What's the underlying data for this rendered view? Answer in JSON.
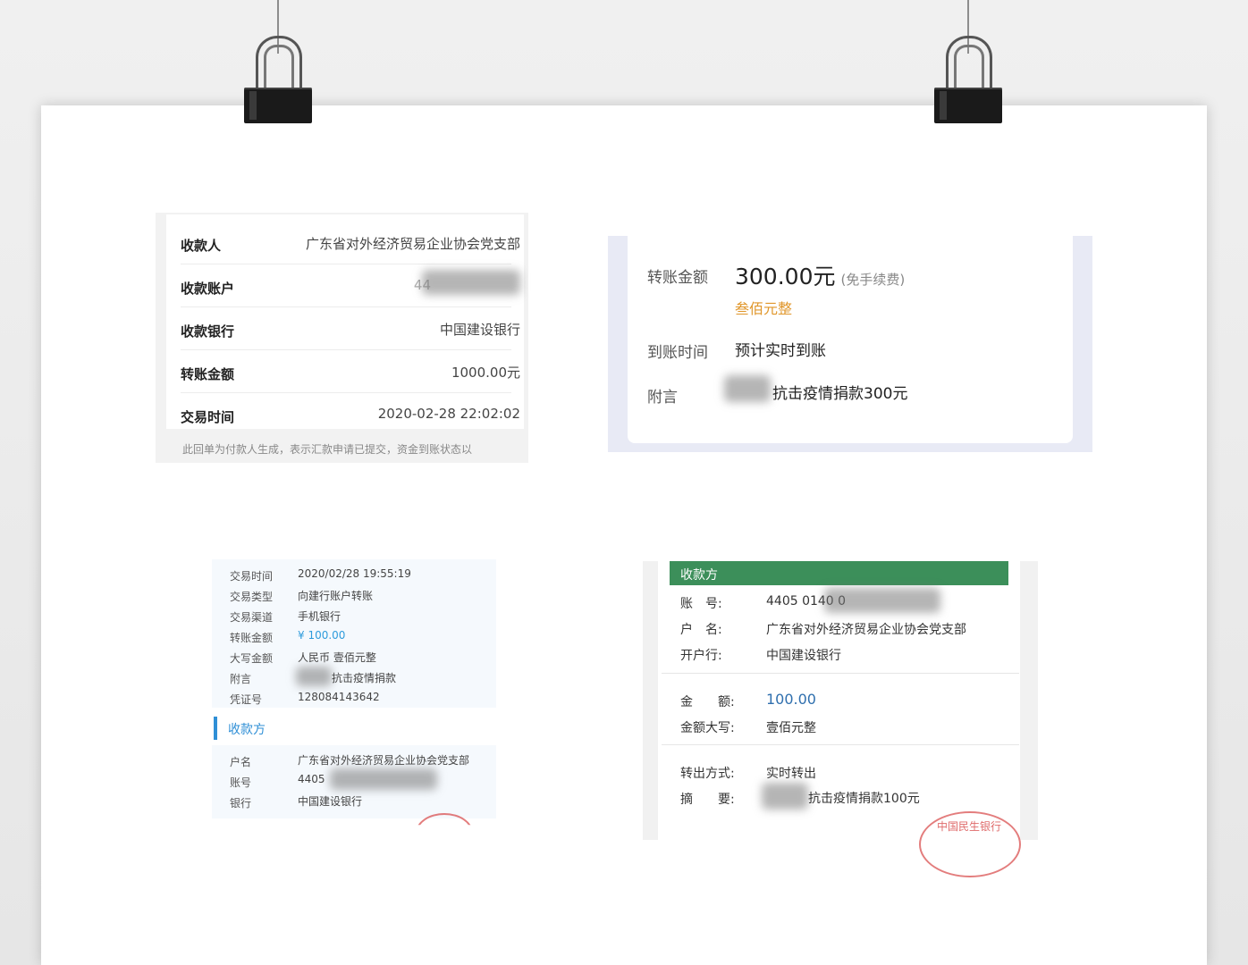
{
  "card1": {
    "rows": [
      {
        "label": "收款人",
        "value": "广东省对外经济贸易企业协会党支部"
      },
      {
        "label": "收款账户",
        "value": "44"
      },
      {
        "label": "收款银行",
        "value": "中国建设银行"
      },
      {
        "label": "转账金额",
        "value": "1000.00元"
      },
      {
        "label": "交易时间",
        "value": "2020-02-28 22:02:02"
      }
    ],
    "footer": "此回单为付款人生成，表示汇款申请已提交，资金到账状态以"
  },
  "card2": {
    "amount_label": "转账金额",
    "amount": "300.00元",
    "fee_note": "(免手续费)",
    "amount_caps": "叁佰元整",
    "arrival_label": "到账时间",
    "arrival_value": "预计实时到账",
    "memo_label": "附言",
    "memo_value": "抗击疫情捐款300元"
  },
  "card3": {
    "rows": [
      {
        "label": "交易时间",
        "value": "2020/02/28 19:55:19"
      },
      {
        "label": "交易类型",
        "value": "向建行账户转账"
      },
      {
        "label": "交易渠道",
        "value": "手机银行"
      },
      {
        "label": "转账金额",
        "value": "¥ 100.00"
      },
      {
        "label": "大写金额",
        "value": "人民币 壹佰元整"
      },
      {
        "label": "附言",
        "value": "抗击疫情捐款"
      },
      {
        "label": "凭证号",
        "value": "128084143642"
      }
    ],
    "payee_header": "收款方",
    "payee_rows": [
      {
        "label": "户名",
        "value": "广东省对外经济贸易企业协会党支部"
      },
      {
        "label": "账号",
        "value": "4405"
      },
      {
        "label": "银行",
        "value": "中国建设银行"
      }
    ]
  },
  "card4": {
    "header": "收款方",
    "rows_a": [
      {
        "label": "账　号:",
        "value": "4405 0140 0"
      },
      {
        "label": "户　名:",
        "value": "广东省对外经济贸易企业协会党支部"
      },
      {
        "label": "开户行:",
        "value": "中国建设银行"
      }
    ],
    "rows_b": [
      {
        "label": "金　　额:",
        "value": "100.00"
      },
      {
        "label": "金额大写:",
        "value": "壹佰元整"
      }
    ],
    "rows_c": [
      {
        "label": "转出方式:",
        "value": "实时转出"
      },
      {
        "label": "摘　　要:",
        "value": "抗击疫情捐款100元"
      }
    ],
    "stamp_text": "中国民生银行"
  },
  "colors": {
    "accent_orange": "#e0962a",
    "accent_blue": "#2f8fd6",
    "header_green": "#3c8f5a",
    "stamp_red": "#d74646"
  }
}
